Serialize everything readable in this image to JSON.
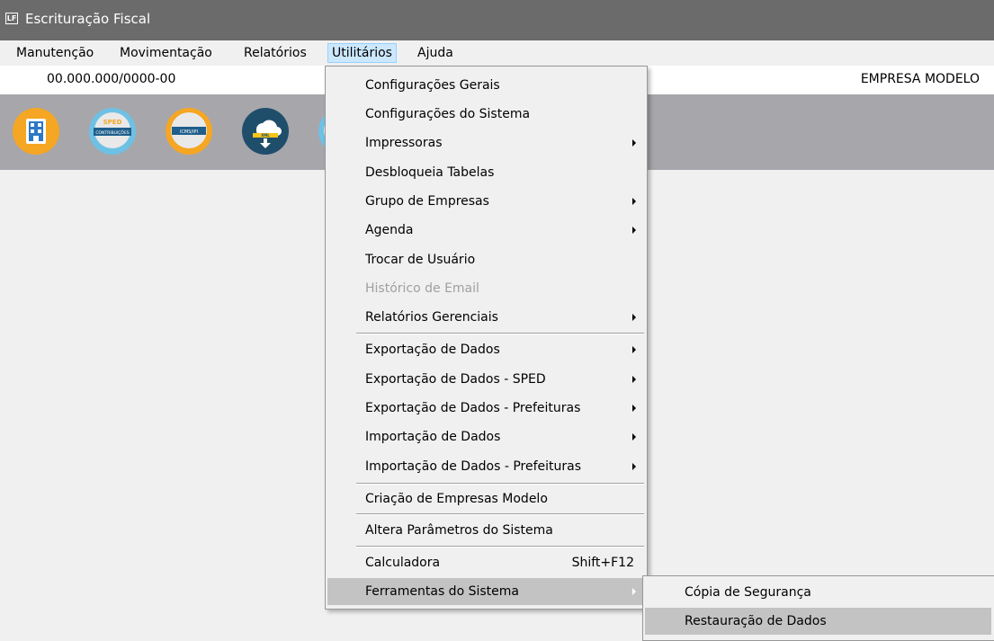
{
  "window": {
    "title": "Escrituração Fiscal",
    "icon_text": "LF"
  },
  "menubar": {
    "items": [
      {
        "label": "Manutenção"
      },
      {
        "label": "Movimentação"
      },
      {
        "label": "Relatórios"
      },
      {
        "label": "Utilitários"
      },
      {
        "label": "Ajuda"
      }
    ]
  },
  "company": {
    "cnpj": "00.000.000/0000-00",
    "name": "EMPRESA MODELO"
  },
  "toolbar": {
    "icons": [
      {
        "name": "company-icon"
      },
      {
        "name": "sped-contribuicoes-icon",
        "top_text": "SPED",
        "band_text": "CONTRIBUIÇÕES"
      },
      {
        "name": "icms-ipi-icon",
        "band_text": "ICMS/IPI"
      },
      {
        "name": "xml-download-icon",
        "band_text": "XML"
      }
    ]
  },
  "utilitarios_menu": {
    "items": [
      {
        "label": "Configurações Gerais"
      },
      {
        "label": "Configurações do Sistema"
      },
      {
        "label": "Impressoras"
      },
      {
        "label": "Desbloqueia Tabelas"
      },
      {
        "label": "Grupo de Empresas"
      },
      {
        "label": "Agenda"
      },
      {
        "label": "Trocar de Usuário"
      },
      {
        "label": "Histórico de Email"
      },
      {
        "label": "Relatórios Gerenciais"
      },
      {
        "label": "Exportação de Dados"
      },
      {
        "label": "Exportação de Dados - SPED"
      },
      {
        "label": "Exportação de Dados - Prefeituras"
      },
      {
        "label": "Importação de Dados"
      },
      {
        "label": "Importação de Dados - Prefeituras"
      },
      {
        "label": "Criação de Empresas Modelo"
      },
      {
        "label": "Altera Parâmetros do Sistema"
      },
      {
        "label": "Calculadora",
        "shortcut": "Shift+F12"
      },
      {
        "label": "Ferramentas do Sistema"
      }
    ]
  },
  "ferramentas_submenu": {
    "items": [
      {
        "label": "Cópia de Segurança"
      },
      {
        "label": "Restauração de Dados"
      }
    ]
  }
}
